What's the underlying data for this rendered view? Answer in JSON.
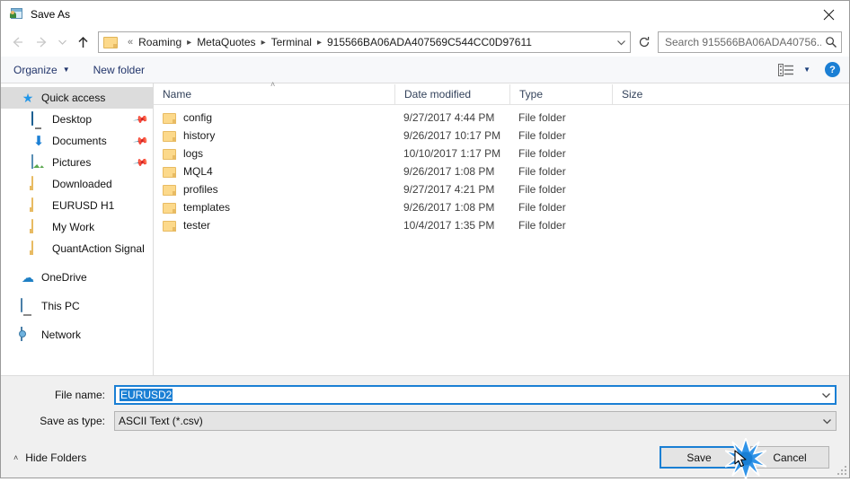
{
  "window": {
    "title": "Save As",
    "title_icon": "save-as-window-icon",
    "close_icon": "close-icon"
  },
  "navigation": {
    "back_icon": "back-arrow-icon",
    "forward_icon": "forward-arrow-icon",
    "recent_icon": "chevron-down-icon",
    "up_icon": "up-arrow-icon",
    "refresh_icon": "refresh-icon",
    "folder_icon": "folder-icon",
    "dropdown_icon": "chevron-down-icon",
    "path_prefix": "«",
    "breadcrumbs": [
      "Roaming",
      "MetaQuotes",
      "Terminal",
      "915566BA06ADA407569C544CC0D97611"
    ]
  },
  "search": {
    "placeholder": "Search 915566BA06ADA40756...",
    "icon": "search-icon"
  },
  "toolbar": {
    "organize_label": "Organize",
    "organize_caret": "▼",
    "new_folder_label": "New folder",
    "view_icon": "list-view-icon",
    "view_caret": "▼",
    "help_label": "?",
    "help_icon": "help-icon"
  },
  "sidebar": {
    "items": [
      {
        "label": "Quick access",
        "icon": "star-icon",
        "selected": true,
        "indent": false,
        "pinned": false
      },
      {
        "label": "Desktop",
        "icon": "monitor-icon",
        "selected": false,
        "indent": true,
        "pinned": true
      },
      {
        "label": "Documents",
        "icon": "down-arrow-icon",
        "selected": false,
        "indent": true,
        "pinned": true
      },
      {
        "label": "Pictures",
        "icon": "pictures-icon",
        "selected": false,
        "indent": true,
        "pinned": true
      },
      {
        "label": "Downloaded",
        "icon": "folder-icon",
        "selected": false,
        "indent": true,
        "pinned": false
      },
      {
        "label": "EURUSD H1",
        "icon": "folder-icon",
        "selected": false,
        "indent": true,
        "pinned": false
      },
      {
        "label": "My Work",
        "icon": "folder-icon",
        "selected": false,
        "indent": true,
        "pinned": false
      },
      {
        "label": "QuantAction Signal",
        "icon": "folder-icon",
        "selected": false,
        "indent": true,
        "pinned": false
      },
      {
        "label": "OneDrive",
        "icon": "cloud-icon",
        "selected": false,
        "indent": false,
        "pinned": false
      },
      {
        "label": "This PC",
        "icon": "pc-icon",
        "selected": false,
        "indent": false,
        "pinned": false
      },
      {
        "label": "Network",
        "icon": "network-icon",
        "selected": false,
        "indent": false,
        "pinned": false
      }
    ],
    "pin_glyph": "📌"
  },
  "filelist": {
    "columns": [
      "Name",
      "Date modified",
      "Type",
      "Size"
    ],
    "sort_caret": "˄",
    "rows": [
      {
        "name": "config",
        "date": "9/27/2017 4:44 PM",
        "type": "File folder",
        "size": ""
      },
      {
        "name": "history",
        "date": "9/26/2017 10:17 PM",
        "type": "File folder",
        "size": ""
      },
      {
        "name": "logs",
        "date": "10/10/2017 1:17 PM",
        "type": "File folder",
        "size": ""
      },
      {
        "name": "MQL4",
        "date": "9/26/2017 1:08 PM",
        "type": "File folder",
        "size": ""
      },
      {
        "name": "profiles",
        "date": "9/27/2017 4:21 PM",
        "type": "File folder",
        "size": ""
      },
      {
        "name": "templates",
        "date": "9/26/2017 1:08 PM",
        "type": "File folder",
        "size": ""
      },
      {
        "name": "tester",
        "date": "10/4/2017 1:35 PM",
        "type": "File folder",
        "size": ""
      }
    ]
  },
  "form": {
    "filename_label": "File name:",
    "filename_value": "EURUSD2",
    "filetype_label": "Save as type:",
    "filetype_value": "ASCII Text (*.csv)",
    "dropdown_icon": "chevron-down-icon"
  },
  "footer": {
    "hide_folders_label": "Hide Folders",
    "hide_folders_caret": "˄",
    "save_label": "Save",
    "cancel_label": "Cancel"
  },
  "colors": {
    "accent": "#1a7fd4",
    "folder": "#fcd98b",
    "selection": "#dcdcdc",
    "toolbar_text": "#22356b",
    "panel": "#f0f0f0"
  }
}
